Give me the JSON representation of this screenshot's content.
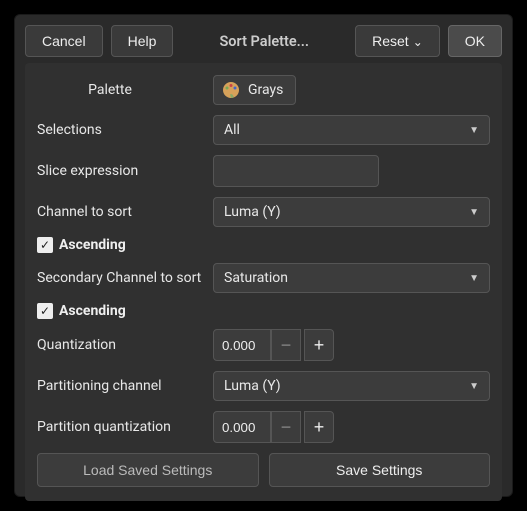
{
  "topbar": {
    "cancel": "Cancel",
    "help": "Help",
    "title": "Sort Palette...",
    "reset": "Reset",
    "ok": "OK"
  },
  "form": {
    "palette_label": "Palette",
    "palette_value": "Grays",
    "selections_label": "Selections",
    "selections_value": "All",
    "slice_label": "Slice expression",
    "slice_value": "",
    "channel_label": "Channel to sort",
    "channel_value": "Luma (Y)",
    "ascending1_label": "Ascending",
    "ascending1_checked": true,
    "secondary_label": "Secondary Channel to sort",
    "secondary_value": "Saturation",
    "ascending2_label": "Ascending",
    "ascending2_checked": true,
    "quantization_label": "Quantization",
    "quantization_value": "0.000",
    "partitioning_label": "Partitioning channel",
    "partitioning_value": "Luma (Y)",
    "partition_quant_label": "Partition quantization",
    "partition_quant_value": "0.000",
    "load_settings": "Load Saved Settings",
    "save_settings": "Save Settings"
  }
}
